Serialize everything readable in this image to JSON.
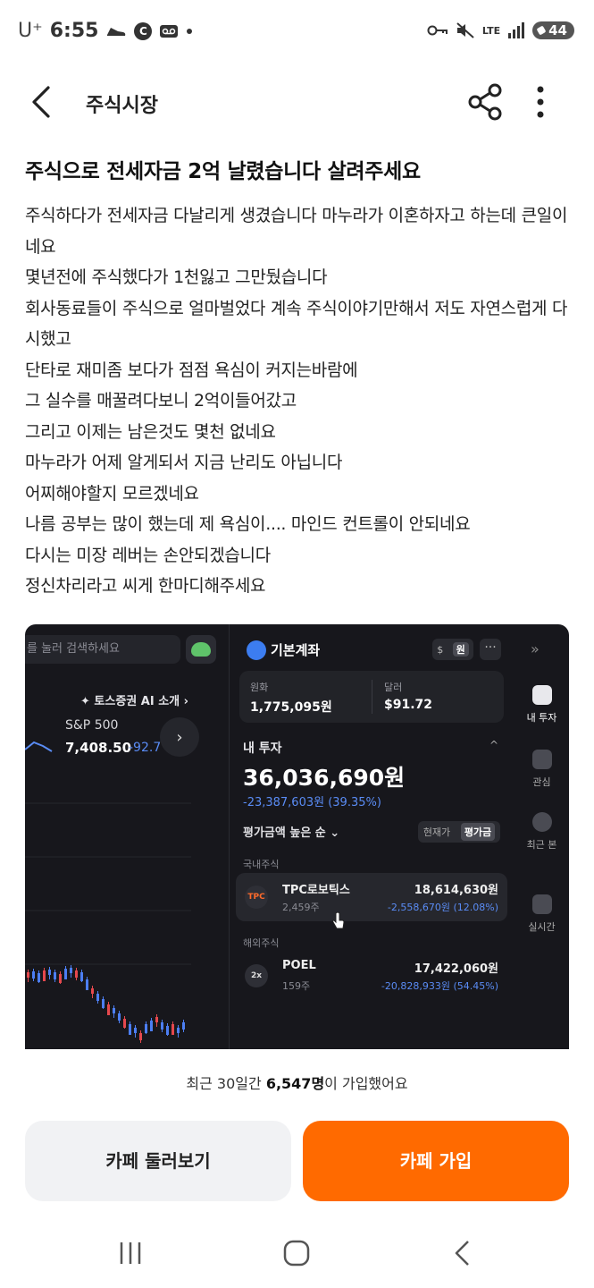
{
  "status_bar": {
    "carrier": "U⁺",
    "time": "6:55",
    "circle_letter": "C",
    "network": "LTE",
    "battery": "44"
  },
  "header": {
    "title": "주식시장"
  },
  "post": {
    "title": "주식으로 전세자금 2억 날렸습니다 살려주세요",
    "body_lines": [
      "주식하다가 전세자금 다날리게 생겼습니다 마누라가 이혼하자고 하는데 큰일이네요",
      "몇년전에 주식했다가 1천잃고 그만뒀습니다",
      "회사동료들이 주식으로 얼마벌었다 계속 주식이야기만해서 저도 자연스럽게 다시했고",
      "단타로 재미좀 보다가 점점 욕심이 커지는바람에",
      "그 실수를 매꿀려다보니  2억이들어갔고",
      "그리고 이제는 남은것도 몇천 없네요",
      "마누라가 어제 알게되서 지금 난리도 아닙니다",
      "어찌해야할지 모르겠네요",
      "나름 공부는 많이 했는데 제 욕심이.... 마인드 컨트롤이 안되네요",
      "다시는 미장 레버는 손안되겠습니다",
      "정신차리라고 씨게 한마디해주세요"
    ]
  },
  "screenshot": {
    "search_placeholder": "를 눌러 검색하세요",
    "ai_intro": "✦ 토스증권 AI 소개  ›",
    "index": {
      "name": "S&P 500",
      "value": "7,408.50",
      "change": "-92.7"
    },
    "account": {
      "name": "기본계좌",
      "currency_usd": "$",
      "currency_krw": "원",
      "more": "···"
    },
    "balances": [
      {
        "label": "원화",
        "value": "1,775,095원"
      },
      {
        "label": "달러",
        "value": "$91.72"
      }
    ],
    "investment": {
      "label": "내 투자",
      "total": "36,036,690원",
      "change": "-23,387,603원 (39.35%)",
      "sort": "평가금액 높은 순 ⌄",
      "toggle_current": "현재가",
      "toggle_eval": "평가금"
    },
    "sections": {
      "domestic": "국내주식",
      "overseas": "해외주식"
    },
    "holdings": [
      {
        "logo": "TPC",
        "name": "TPC로보틱스",
        "qty": "2,459주",
        "value": "18,614,630원",
        "change": "-2,558,670원 (12.08%)"
      },
      {
        "logo": "2x",
        "name": "POEL",
        "qty": "159주",
        "value": "17,422,060원",
        "change": "-20,828,933원 (54.45%)"
      }
    ],
    "rail": [
      {
        "label": "내 투자",
        "active": true
      },
      {
        "label": "관심",
        "active": false
      },
      {
        "label": "최근 본",
        "active": false
      },
      {
        "label": "실시간",
        "active": false
      }
    ]
  },
  "bottom": {
    "join_prefix": "최근 30일간 ",
    "join_count": "6,547명",
    "join_suffix": "이 가입했어요",
    "browse_label": "카페 둘러보기",
    "join_label": "카페 가입",
    "join_color": "#ff6a00"
  }
}
